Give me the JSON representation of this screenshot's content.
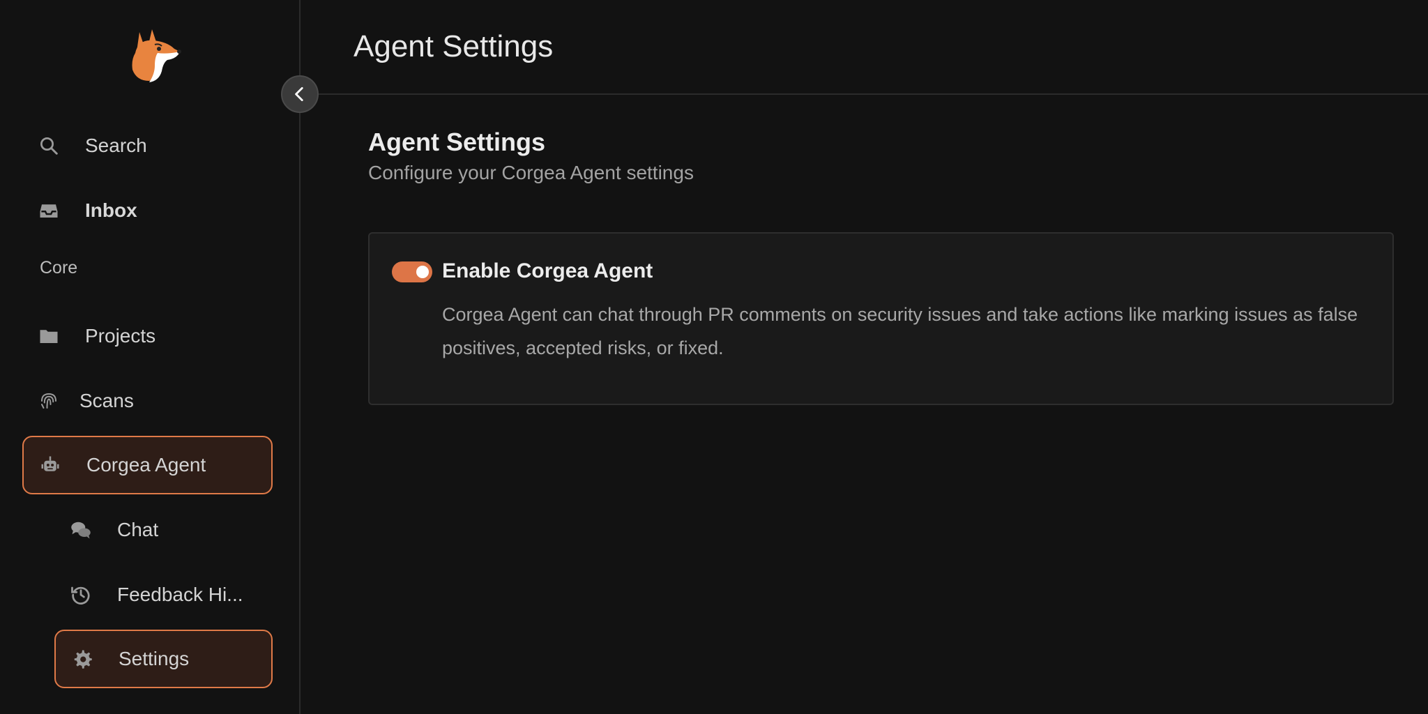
{
  "sidebar": {
    "items": {
      "search": "Search",
      "inbox": "Inbox",
      "projects": "Projects",
      "scans": "Scans",
      "corgea_agent": "Corgea Agent",
      "chat": "Chat",
      "feedback_history": "Feedback Hi...",
      "settings": "Settings"
    },
    "section_core": "Core"
  },
  "header": {
    "title": "Agent Settings"
  },
  "main": {
    "section_title": "Agent Settings",
    "section_subtitle": "Configure your Corgea Agent settings",
    "card": {
      "toggle_enabled": true,
      "title": "Enable Corgea Agent",
      "description": "Corgea Agent can chat through PR comments on security issues and take actions like marking issues as false positives, accepted risks, or fixed."
    }
  },
  "colors": {
    "accent": "#dd7547",
    "active_bg": "#2e1d17",
    "background": "#121212"
  },
  "icons": {
    "logo": "corgi-logo",
    "collapse": "chevron-left-icon",
    "search": "search-icon",
    "inbox": "inbox-icon",
    "projects": "folder-icon",
    "scans": "fingerprint-icon",
    "corgea_agent": "robot-icon",
    "chat": "comments-icon",
    "feedback_history": "history-icon",
    "settings": "gear-icon"
  }
}
